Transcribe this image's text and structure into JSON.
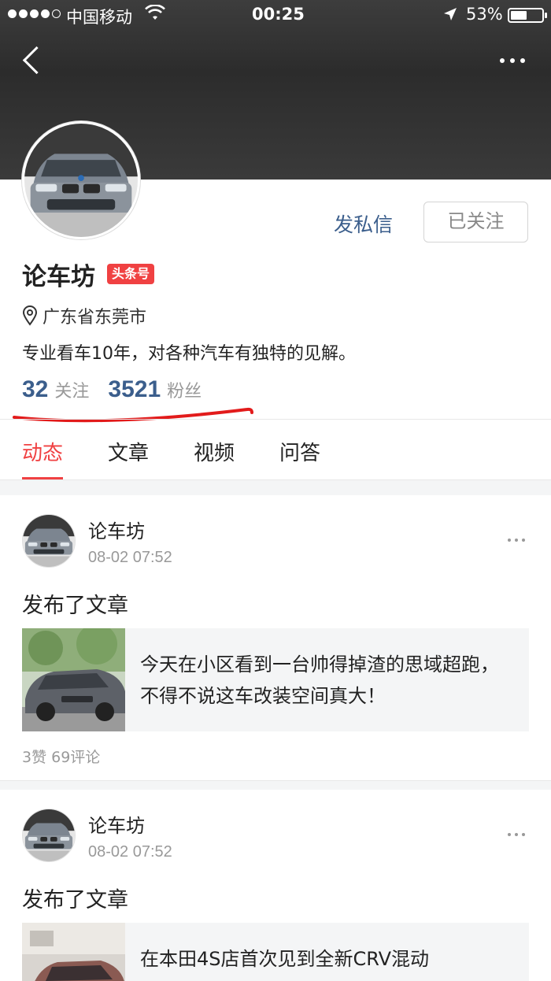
{
  "status_bar": {
    "carrier": "中国移动",
    "time": "00:25",
    "battery": "53%",
    "battery_level": 0.53
  },
  "profile": {
    "name": "论车坊",
    "badge": "头条号",
    "location": "广东省东莞市",
    "bio": "专业看车10年，对各种汽车有独特的见解。",
    "following_count": "32",
    "following_label": "关注",
    "followers_count": "3521",
    "followers_label": "粉丝",
    "message_label": "发私信",
    "follow_label": "已关注"
  },
  "tabs": [
    {
      "label": "动态",
      "active": true
    },
    {
      "label": "文章",
      "active": false
    },
    {
      "label": "视频",
      "active": false
    },
    {
      "label": "问答",
      "active": false
    }
  ],
  "posts": [
    {
      "author": "论车坊",
      "time": "08-02 07:52",
      "action": "发布了文章",
      "article_title": "今天在小区看到一台帅得掉渣的思域超跑，不得不说这车改装空间真大！",
      "stats": "3赞 69评论"
    },
    {
      "author": "论车坊",
      "time": "08-02 07:52",
      "action": "发布了文章",
      "article_title": "在本田4S店首次见到全新CRV混动"
    }
  ],
  "colors": {
    "accent_red": "#f04142",
    "link_blue": "#3b5e8c",
    "header_dark": "#333333"
  }
}
